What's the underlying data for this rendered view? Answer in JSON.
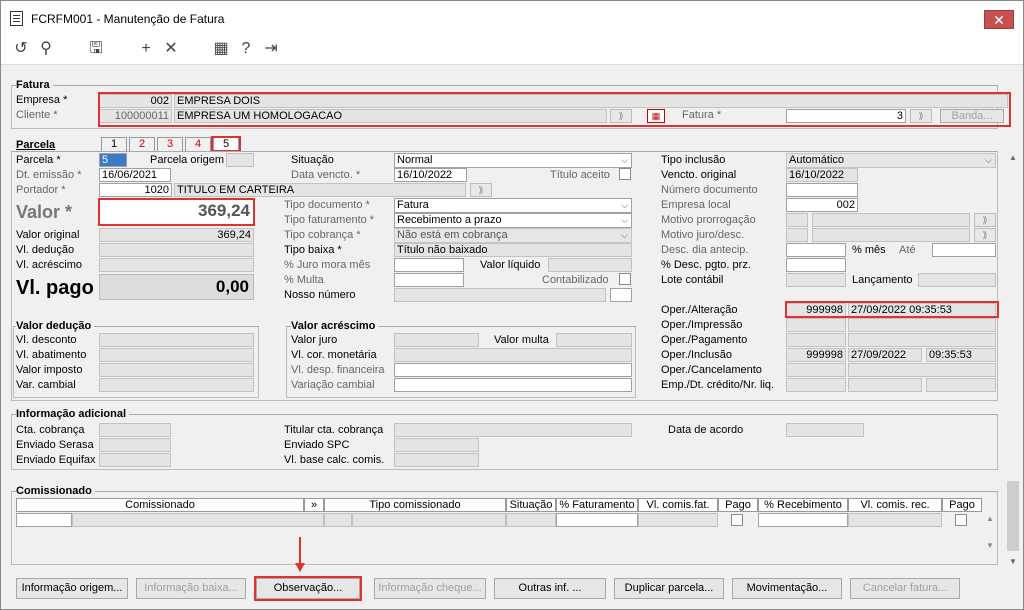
{
  "window": {
    "title": "FCRFM001 - Manutenção de Fatura",
    "close": "✕"
  },
  "toolbar": {
    "icons": [
      "undo-icon",
      "search-icon",
      "save-icon",
      "add-icon",
      "delete-icon",
      "calendar-icon",
      "help-icon",
      "exit-icon"
    ]
  },
  "fatura": {
    "section": "Fatura",
    "empresa_label": "Empresa *",
    "empresa_code": "002",
    "empresa_name": "EMPRESA DOIS",
    "cliente_label": "Cliente *",
    "cliente_code": "100000011",
    "cliente_name": "EMPRESA UM HOMOLOGACAO",
    "fatura_label": "Fatura *",
    "fatura_value": "3",
    "banda_label": "Banda..."
  },
  "parcela": {
    "section": "Parcela",
    "tabs": [
      "1",
      "2",
      "3",
      "4",
      "5"
    ],
    "parcela_label": "Parcela *",
    "parcela_value": "5",
    "parcela_origem_label": "Parcela origem",
    "dt_emissao_label": "Dt. emissão *",
    "dt_emissao_value": "16/06/2021",
    "portador_label": "Portador *",
    "portador_code": "1020",
    "portador_name": "TITULO EM CARTEIRA",
    "valor_label": "Valor *",
    "valor_value": "369,24",
    "valor_original_label": "Valor original",
    "valor_original_value": "369,24",
    "vl_deducao_label": "Vl. dedução",
    "vl_acrescimo_label": "Vl. acréscimo",
    "vl_pago_label": "Vl. pago",
    "vl_pago_value": "0,00",
    "situacao_label": "Situação",
    "situacao_value": "Normal",
    "data_vencto_label": "Data vencto. *",
    "data_vencto_value": "16/10/2022",
    "titulo_aceito_label": "Título aceito",
    "tipo_documento_label": "Tipo documento *",
    "tipo_documento_value": "Fatura",
    "tipo_faturamento_label": "Tipo faturamento *",
    "tipo_faturamento_value": "Recebimento a prazo",
    "tipo_cobranca_label": "Tipo cobrança *",
    "tipo_cobranca_value": "Não está em cobrança",
    "tipo_baixa_label": "Tipo baixa *",
    "tipo_baixa_value": "Título não baixado",
    "juro_mora_label": "% Juro mora mês",
    "valor_liquido_label": "Valor líquido",
    "multa_label": "% Multa",
    "contabilizado_label": "Contabilizado",
    "nosso_numero_label": "Nosso número",
    "tipo_inclusao_label": "Tipo inclusão",
    "tipo_inclusao_value": "Automático",
    "vencto_original_label": "Vencto. original",
    "vencto_original_value": "16/10/2022",
    "numero_documento_label": "Número documento",
    "empresa_local_label": "Empresa local",
    "empresa_local_value": "002",
    "motivo_prorrogacao_label": "Motivo prorrogação",
    "motivo_juro_label": "Motivo juro/desc.",
    "desc_dia_antecip_label": "Desc. dia antecip.",
    "pct_mes_label": "% mês",
    "ate_label": "Até",
    "desc_pgto_prz_label": "% Desc. pgto. prz.",
    "lote_contabil_label": "Lote contábil",
    "lancamento_label": "Lançamento",
    "oper_alteracao_label": "Oper./Alteração",
    "oper_alteracao_user": "999998",
    "oper_alteracao_datetime": "27/09/2022 09:35:53",
    "oper_impressao_label": "Oper./Impressão",
    "oper_pagamento_label": "Oper./Pagamento",
    "oper_inclusao_label": "Oper./Inclusão",
    "oper_inclusao_user": "999998",
    "oper_inclusao_date": "27/09/2022",
    "oper_inclusao_time": "09:35:53",
    "oper_cancelamento_label": "Oper./Cancelamento",
    "emp_dt_credito_label": "Emp./Dt. crédito/Nr. liq."
  },
  "valor_deducao": {
    "section": "Valor dedução",
    "desconto": "Vl. desconto",
    "abatimento": "Vl. abatimento",
    "imposto": "Valor imposto",
    "cambial": "Var. cambial"
  },
  "valor_acrescimo": {
    "section": "Valor acréscimo",
    "juro": "Valor juro",
    "multa": "Valor multa",
    "cor_monetaria": "Vl. cor. monetária",
    "desp_financeira": "Vl. desp. financeira",
    "var_cambial": "Variação cambial"
  },
  "info_adicional": {
    "section": "Informação adicional",
    "cta_cobranca": "Cta. cobrança",
    "enviado_serasa": "Enviado Serasa",
    "enviado_equifax": "Enviado Equifax",
    "titular_cta": "Titular cta. cobrança",
    "enviado_spc": "Enviado SPC",
    "vl_base_calc": "Vl. base calc. comis.",
    "data_acordo": "Data de acordo"
  },
  "comissionado": {
    "section": "Comissionado",
    "columns": [
      "Comissionado",
      "»",
      "Tipo comissionado",
      "Situação",
      "% Faturamento",
      "Vl. comis.fat.",
      "Pago",
      "% Recebimento",
      "Vl. comis. rec.",
      "Pago"
    ]
  },
  "buttons": {
    "info_origem": "Informação origem...",
    "info_baixa": "Informação baixa...",
    "observacao": "Observação...",
    "info_cheque": "Informação cheque...",
    "outras_inf": "Outras inf. ...",
    "duplicar": "Duplicar parcela...",
    "movimentacao": "Movimentação...",
    "cancelar": "Cancelar fatura..."
  },
  "colors": {
    "annotation": "#e03030",
    "close": "#c75050"
  }
}
